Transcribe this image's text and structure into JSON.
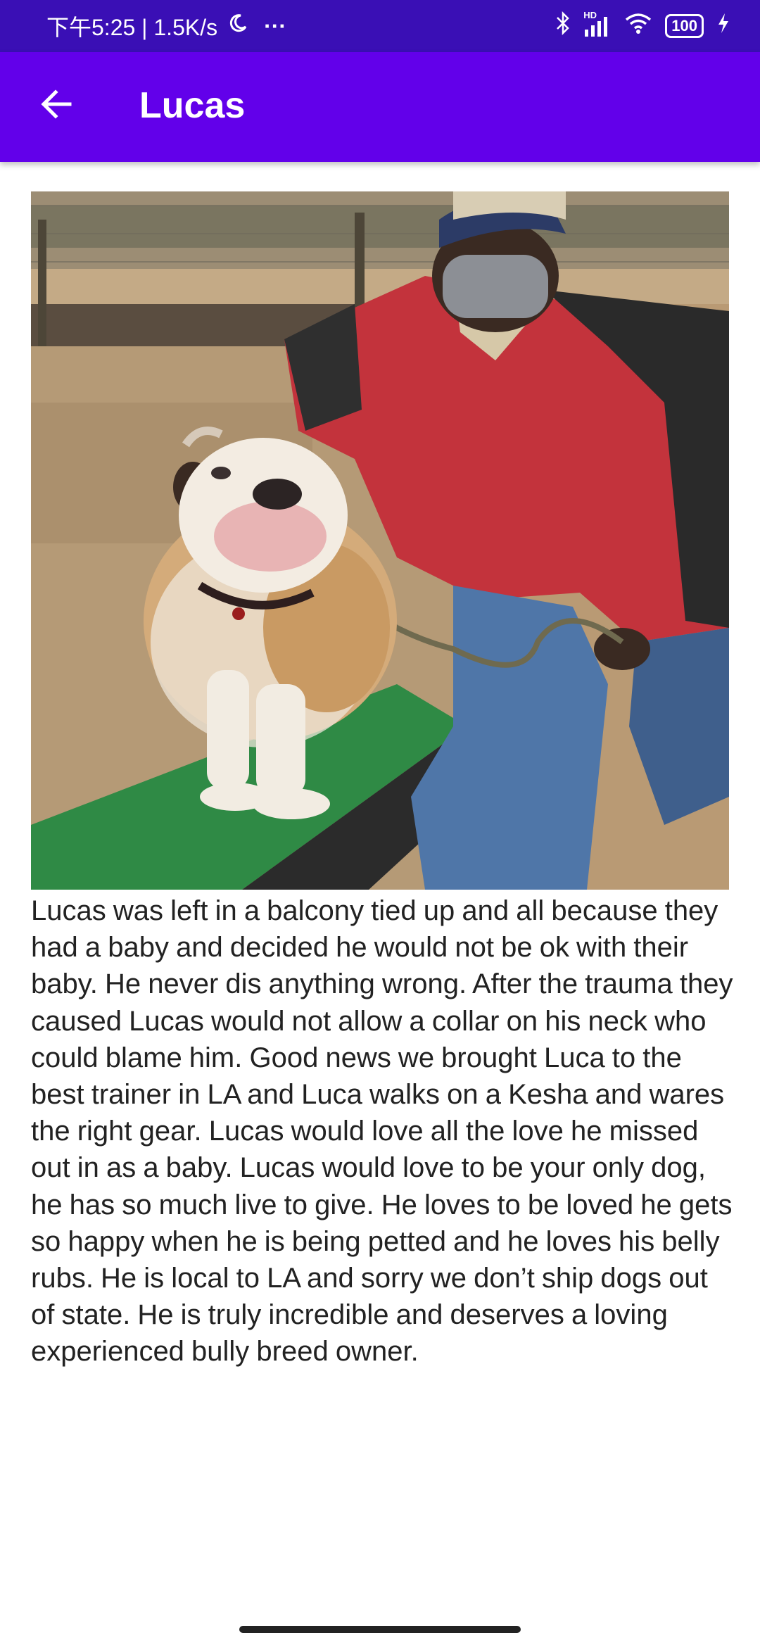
{
  "status_bar": {
    "time_speed": "下午5:25 | 1.5K/s",
    "more_dots": "···",
    "network_label": "HD",
    "battery": "100",
    "icons": [
      "moon-icon",
      "bluetooth-icon",
      "signal-icon",
      "wifi-icon",
      "battery-icon",
      "charging-icon"
    ]
  },
  "app_bar": {
    "title": "Lucas",
    "back_icon": "arrow-left-icon",
    "color": "#6200ea"
  },
  "photo": {
    "subject": "dog-photo"
  },
  "description": "Lucas was left in a balcony tied up and all because they had a baby and decided he would not be ok with their baby. He never dis anything wrong. After the trauma they caused Lucas would not allow a collar on his neck who could blame him. Good news we brought Luca to the best trainer in LA and Luca walks on a Kesha and wares the right gear. Lucas would love all the love he missed out in as a baby. Lucas would love to be your only dog, he has so much live to give. He loves to be loved he gets so happy when he is being petted and he loves his belly rubs. He is local to LA and sorry we don’t ship dogs out of state. He is truly incredible and deserves a loving experienced bully breed owner."
}
